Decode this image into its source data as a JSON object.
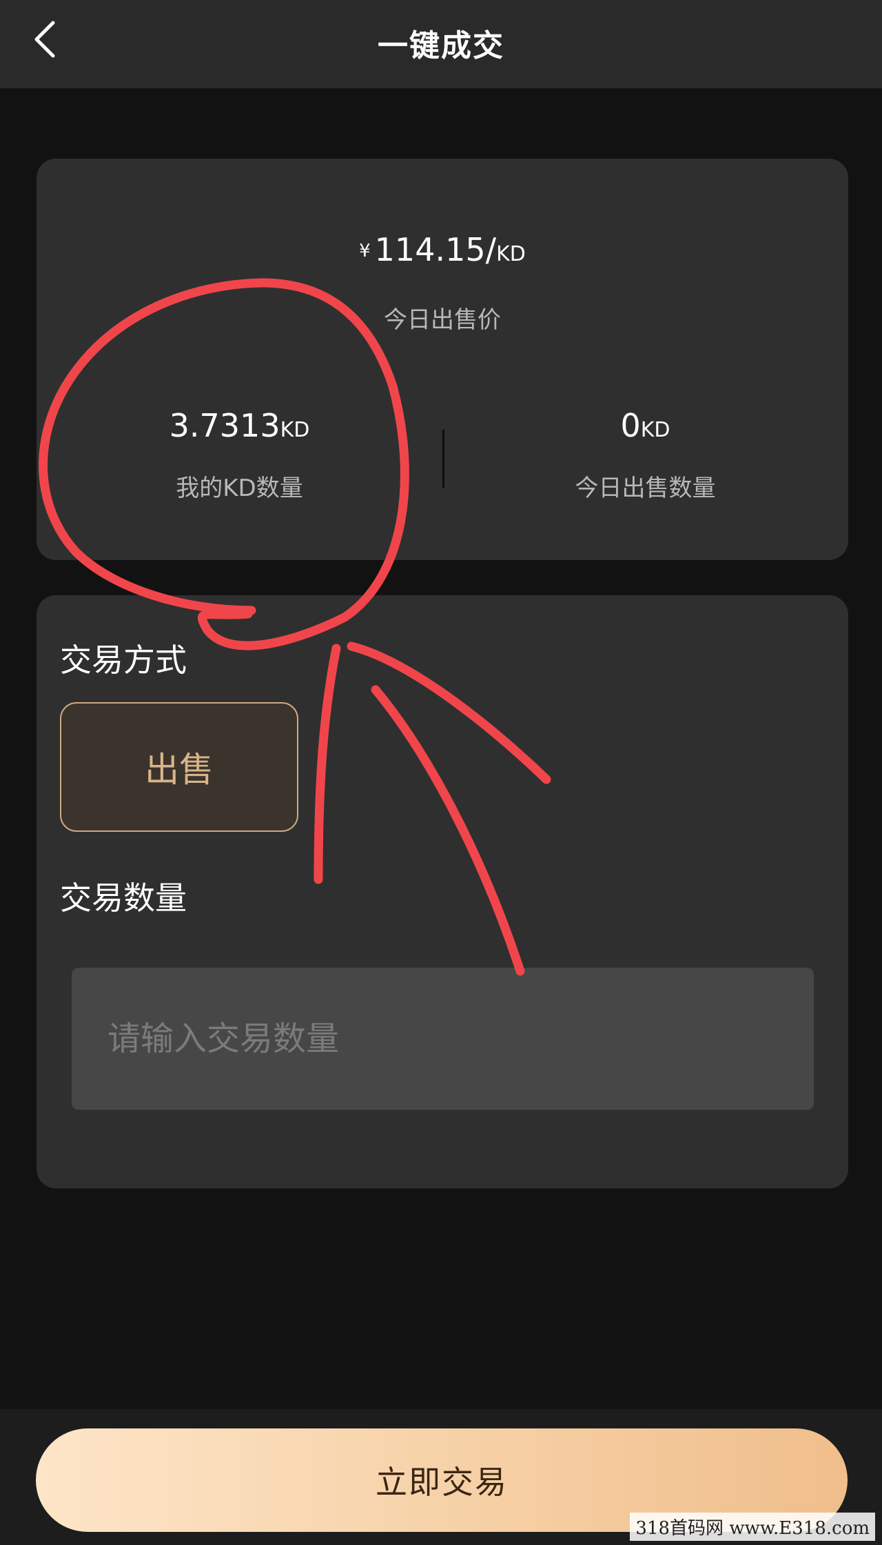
{
  "header": {
    "title": "一键成交"
  },
  "price_card": {
    "currency_symbol": "¥",
    "price": "114.15/",
    "price_unit": "KD",
    "price_label": "今日出售价",
    "my_kd": {
      "value": "3.7313",
      "unit": "KD",
      "label": "我的KD数量"
    },
    "sold_today": {
      "value": "0",
      "unit": "KD",
      "label": "今日出售数量"
    }
  },
  "trade": {
    "method_title": "交易方式",
    "sell_label": "出售",
    "quantity_title": "交易数量",
    "quantity_placeholder": "请输入交易数量"
  },
  "footer": {
    "trade_now_label": "立即交易"
  },
  "watermark": "318首码网 www.E318.com",
  "colors": {
    "background": "#121212",
    "card": "#2f2f2f",
    "accent_gold": "#d8b48c",
    "button_gradient_start": "#fde5c8",
    "button_gradient_end": "#efbe8b",
    "annotation_red": "#f0464b"
  }
}
